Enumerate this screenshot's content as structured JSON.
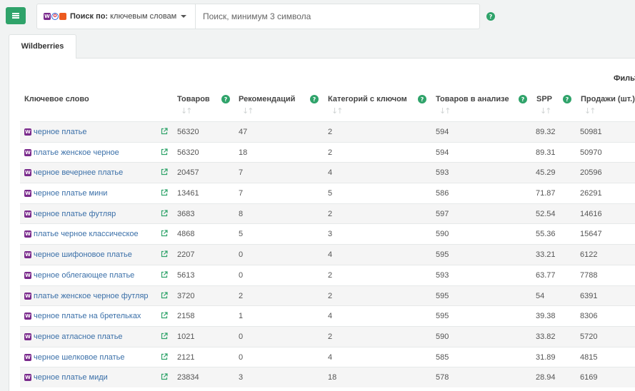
{
  "toolbar": {
    "search_mode_label": "Поиск по:",
    "search_mode_value": "ключевым словам",
    "search_placeholder": "Поиск, минимум 3 символа",
    "help_icon_glyph": "?"
  },
  "tabs": [
    {
      "label": "Wildberries",
      "active": true
    }
  ],
  "filter_label": "Фильт",
  "table": {
    "columns": {
      "keyword": "Ключевое слово",
      "products": "Товаров",
      "recommendations": "Рекомендаций",
      "categories": "Категорий с ключом",
      "in_analysis": "Товаров в анализе",
      "spp": "SPP",
      "sales": "Продажи (шт.)"
    },
    "sort_icon": "↓↑",
    "rows": [
      {
        "keyword": "черное платье",
        "products": "56320",
        "recommendations": "47",
        "categories": "2",
        "in_analysis": "594",
        "spp": "89.32",
        "sales": "50981"
      },
      {
        "keyword": "платье женское черное",
        "products": "56320",
        "recommendations": "18",
        "categories": "2",
        "in_analysis": "594",
        "spp": "89.31",
        "sales": "50970"
      },
      {
        "keyword": "черное вечернее платье",
        "products": "20457",
        "recommendations": "7",
        "categories": "4",
        "in_analysis": "593",
        "spp": "45.29",
        "sales": "20596"
      },
      {
        "keyword": "черное платье мини",
        "products": "13461",
        "recommendations": "7",
        "categories": "5",
        "in_analysis": "586",
        "spp": "71.87",
        "sales": "26291"
      },
      {
        "keyword": "черное платье футляр",
        "products": "3683",
        "recommendations": "8",
        "categories": "2",
        "in_analysis": "597",
        "spp": "52.54",
        "sales": "14616"
      },
      {
        "keyword": "платье черное классическое",
        "products": "4868",
        "recommendations": "5",
        "categories": "3",
        "in_analysis": "590",
        "spp": "55.36",
        "sales": "15647"
      },
      {
        "keyword": "черное шифоновое платье",
        "products": "2207",
        "recommendations": "0",
        "categories": "4",
        "in_analysis": "595",
        "spp": "33.21",
        "sales": "6122"
      },
      {
        "keyword": "черное облегающее платье",
        "products": "5613",
        "recommendations": "0",
        "categories": "2",
        "in_analysis": "593",
        "spp": "63.77",
        "sales": "7788"
      },
      {
        "keyword": "платье женское черное футляр",
        "products": "3720",
        "recommendations": "2",
        "categories": "2",
        "in_analysis": "595",
        "spp": "54",
        "sales": "6391"
      },
      {
        "keyword": "черное платье на бретельках",
        "products": "2158",
        "recommendations": "1",
        "categories": "4",
        "in_analysis": "595",
        "spp": "39.38",
        "sales": "8306"
      },
      {
        "keyword": "черное атласное платье",
        "products": "1021",
        "recommendations": "0",
        "categories": "2",
        "in_analysis": "590",
        "spp": "33.82",
        "sales": "5720"
      },
      {
        "keyword": "черное шелковое платье",
        "products": "2121",
        "recommendations": "0",
        "categories": "4",
        "in_analysis": "585",
        "spp": "31.89",
        "sales": "4815"
      },
      {
        "keyword": "черное платье миди",
        "products": "23834",
        "recommendations": "3",
        "categories": "18",
        "in_analysis": "578",
        "spp": "28.94",
        "sales": "6169"
      }
    ]
  },
  "colors": {
    "accent": "#2fa36a",
    "link": "#3a6fa8",
    "wildberries": "#7a2a8c"
  },
  "icons": {
    "marketplace_badge": "W",
    "ozon_badge": "O"
  }
}
